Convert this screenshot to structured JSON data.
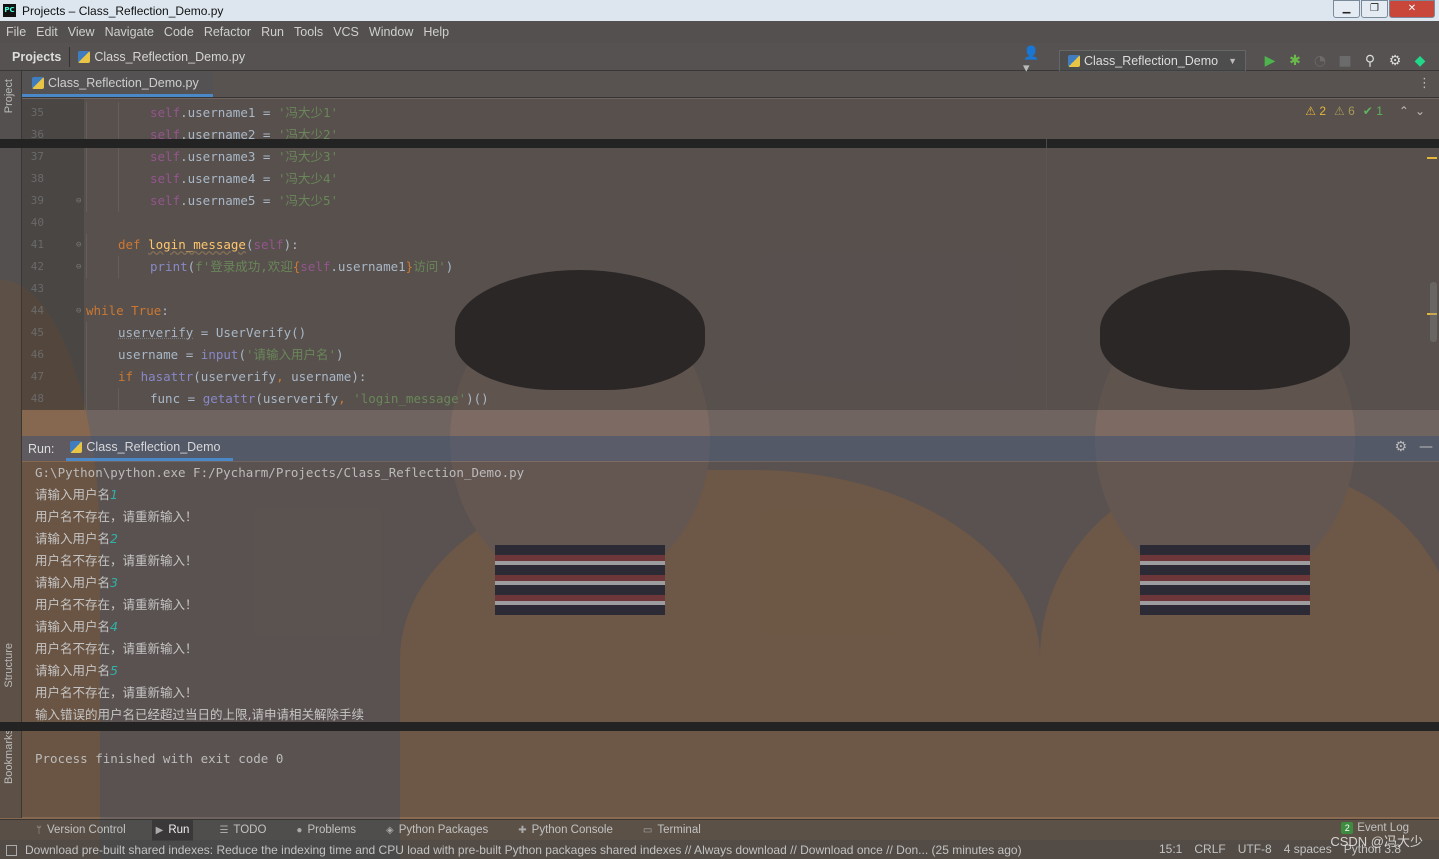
{
  "window": {
    "title": "Projects – Class_Reflection_Demo.py",
    "app_icon_text": "PC",
    "controls": {
      "minimize": "▁",
      "maximize": "❐",
      "close": "✕"
    }
  },
  "menu": [
    "File",
    "Edit",
    "View",
    "Navigate",
    "Code",
    "Refactor",
    "Run",
    "Tools",
    "VCS",
    "Window",
    "Help"
  ],
  "breadcrumb": {
    "project": "Projects",
    "file": "Class_Reflection_Demo.py"
  },
  "toolbar": {
    "run_config": "Class_Reflection_Demo",
    "icons": [
      "user-icon",
      "run-icon",
      "debug-icon",
      "coverage-icon",
      "stop-icon",
      "search-icon",
      "settings-icon",
      "jetbrains-icon"
    ]
  },
  "side_tabs": {
    "project": "Project",
    "structure": "Structure",
    "bookmarks": "Bookmarks"
  },
  "editor": {
    "tab": "Class_Reflection_Demo.py",
    "inspections": {
      "warnings": "2",
      "weak_warnings": "6",
      "ok": "1"
    },
    "lines": [
      {
        "n": "35",
        "indent": 2,
        "tokens": [
          [
            "slf",
            "self"
          ],
          [
            "plain",
            ".username1 = "
          ],
          [
            "str",
            "'冯大少1'"
          ]
        ]
      },
      {
        "n": "36",
        "indent": 2,
        "tokens": [
          [
            "slf",
            "self"
          ],
          [
            "plain",
            ".username2 = "
          ],
          [
            "str",
            "'冯大少2'"
          ]
        ]
      },
      {
        "n": "37",
        "indent": 2,
        "tokens": [
          [
            "slf",
            "self"
          ],
          [
            "plain",
            ".username3 = "
          ],
          [
            "str",
            "'冯大少3'"
          ]
        ]
      },
      {
        "n": "38",
        "indent": 2,
        "tokens": [
          [
            "slf",
            "self"
          ],
          [
            "plain",
            ".username4 = "
          ],
          [
            "str",
            "'冯大少4'"
          ]
        ]
      },
      {
        "n": "39",
        "indent": 2,
        "tokens": [
          [
            "slf",
            "self"
          ],
          [
            "plain",
            ".username5 = "
          ],
          [
            "str",
            "'冯大少5'"
          ]
        ]
      },
      {
        "n": "40",
        "indent": 0,
        "tokens": []
      },
      {
        "n": "41",
        "indent": 1,
        "tokens": [
          [
            "kw",
            "def "
          ],
          [
            "fn",
            "login_message"
          ],
          [
            "plain",
            "("
          ],
          [
            "slf",
            "self"
          ],
          [
            "plain",
            "):"
          ]
        ]
      },
      {
        "n": "42",
        "indent": 2,
        "tokens": [
          [
            "bi",
            "print"
          ],
          [
            "plain",
            "("
          ],
          [
            "str",
            "f'登录成功,欢迎"
          ],
          [
            "kw",
            "{"
          ],
          [
            "slf",
            "self"
          ],
          [
            "plain",
            ".username1"
          ],
          [
            "kw",
            "}"
          ],
          [
            "str",
            "访问'"
          ],
          [
            "plain",
            ")"
          ]
        ]
      },
      {
        "n": "43",
        "indent": 0,
        "tokens": []
      },
      {
        "n": "44",
        "indent": 0,
        "tokens": [
          [
            "kw",
            "while "
          ],
          [
            "kw",
            "True"
          ],
          [
            "plain",
            ":"
          ]
        ]
      },
      {
        "n": "45",
        "indent": 1,
        "tokens": [
          [
            "var",
            "userverify"
          ],
          [
            "plain",
            " = UserVerify()"
          ]
        ]
      },
      {
        "n": "46",
        "indent": 1,
        "tokens": [
          [
            "plain",
            "username = "
          ],
          [
            "bi",
            "input"
          ],
          [
            "plain",
            "("
          ],
          [
            "str",
            "'请输入用户名'"
          ],
          [
            "plain",
            ")"
          ]
        ]
      },
      {
        "n": "47",
        "indent": 1,
        "tokens": [
          [
            "kw",
            "if "
          ],
          [
            "bi",
            "hasattr"
          ],
          [
            "plain",
            "(userverify"
          ],
          [
            "kw",
            ", "
          ],
          [
            "plain",
            "username):"
          ]
        ]
      },
      {
        "n": "48",
        "indent": 2,
        "tokens": [
          [
            "plain",
            "func = "
          ],
          [
            "bi",
            "getattr"
          ],
          [
            "plain",
            "(userverify"
          ],
          [
            "kw",
            ", "
          ],
          [
            "str",
            "'login_message'"
          ],
          [
            "plain",
            ")()"
          ]
        ]
      }
    ]
  },
  "run": {
    "label": "Run:",
    "tab": "Class_Reflection_Demo",
    "command": "G:\\Python\\python.exe F:/Pycharm/Projects/Class_Reflection_Demo.py",
    "output": [
      {
        "prompt": "请输入用户名",
        "input": "1"
      },
      {
        "text": "用户名不存在，请重新输入！"
      },
      {
        "prompt": "请输入用户名",
        "input": "2"
      },
      {
        "text": "用户名不存在，请重新输入！"
      },
      {
        "prompt": "请输入用户名",
        "input": "3"
      },
      {
        "text": "用户名不存在，请重新输入！"
      },
      {
        "prompt": "请输入用户名",
        "input": "4"
      },
      {
        "text": "用户名不存在，请重新输入！"
      },
      {
        "prompt": "请输入用户名",
        "input": "5"
      },
      {
        "text": "用户名不存在，请重新输入！"
      },
      {
        "text": "输入错误的用户名已经超过当日的上限,请申请相关解除手续"
      }
    ],
    "exit": "Process finished with exit code 0"
  },
  "tool_windows": [
    "Version Control",
    "Run",
    "TODO",
    "Problems",
    "Python Packages",
    "Python Console",
    "Terminal"
  ],
  "event_log": {
    "count": "2",
    "label": "Event Log"
  },
  "status": {
    "message": "Download pre-built shared indexes: Reduce the indexing time and CPU load with pre-built Python packages shared indexes // Always download // Download once // Don... (25 minutes ago)",
    "position": "15:1",
    "line_sep": "CRLF",
    "encoding": "UTF-8",
    "indent": "4 spaces",
    "interpreter": "Python 3.8"
  },
  "watermark": "CSDN @冯大少"
}
